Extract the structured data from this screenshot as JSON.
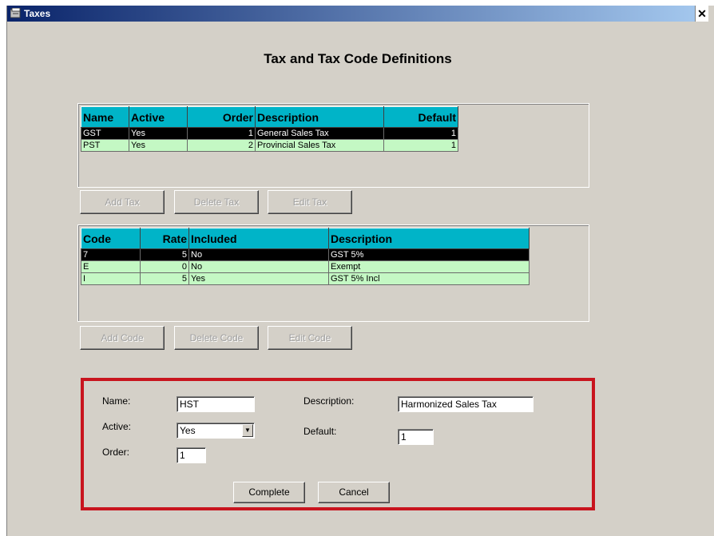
{
  "window": {
    "title": "Taxes",
    "close_glyph": "✕",
    "icon": "app-icon"
  },
  "heading": "Tax and Tax Code Definitions",
  "tax_grid": {
    "columns": [
      "Name",
      "Active",
      "Order",
      "Description",
      "Default"
    ],
    "rows": [
      {
        "name": "GST",
        "active": "Yes",
        "order": "1",
        "description": "General Sales Tax",
        "default": "1",
        "selected": true
      },
      {
        "name": "PST",
        "active": "Yes",
        "order": "2",
        "description": "Provincial Sales Tax",
        "default": "1",
        "selected": false
      }
    ]
  },
  "tax_buttons": {
    "add": "Add Tax",
    "delete": "Delete Tax",
    "edit": "Edit Tax"
  },
  "code_grid": {
    "columns": [
      "Code",
      "Rate",
      "Included",
      "Description"
    ],
    "rows": [
      {
        "code": "7",
        "rate": "5",
        "included": "No",
        "description": "GST 5%",
        "selected": true
      },
      {
        "code": "E",
        "rate": "0",
        "included": "No",
        "description": "Exempt",
        "selected": false
      },
      {
        "code": "I",
        "rate": "5",
        "included": "Yes",
        "description": "GST 5% Incl",
        "selected": false
      }
    ]
  },
  "code_buttons": {
    "add": "Add Code",
    "delete": "Delete Code",
    "edit": "Edit Code"
  },
  "form": {
    "name_label": "Name:",
    "name_value": "HST",
    "active_label": "Active:",
    "active_value": "Yes",
    "order_label": "Order:",
    "order_value": "1",
    "description_label": "Description:",
    "description_value": "Harmonized Sales Tax",
    "default_label": "Default:",
    "default_value": "1",
    "complete": "Complete",
    "cancel": "Cancel"
  },
  "colors": {
    "header": "#00b4c8",
    "row": "#c4f8c4",
    "selected": "#000000",
    "highlight_border": "#c8141e",
    "window_bg": "#d4d0c8"
  }
}
